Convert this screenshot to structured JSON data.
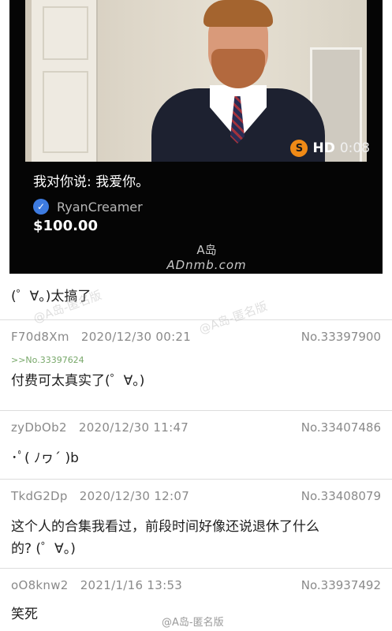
{
  "video": {
    "badge_coin": "S",
    "badge_hd": "HD",
    "duration": "0:08",
    "message": "我对你说: 我爱你。",
    "verified_mark": "✓",
    "username": "RyanCreamer",
    "amount": "$100.00",
    "logo_line1": "A岛",
    "logo_line2": "ADnmb.com"
  },
  "op_text": "(゜∀。)太搞了",
  "replies": [
    {
      "uid": "F70d8Xm",
      "datetime": "2020/12/30 00:21",
      "number": "No.33397900",
      "quote": ">>No.33397624",
      "text": "付费可太真实了(゜∀。)"
    },
    {
      "uid": "zyDbOb2",
      "datetime": "2020/12/30 11:47",
      "number": "No.33407486",
      "text": "･ﾟ( ﾉヮ´ )b"
    },
    {
      "uid": "TkdG2Dp",
      "datetime": "2020/12/30 12:07",
      "number": "No.33408079",
      "text_line1": "这个人的合集我看过，前段时间好像还说退休了什么",
      "text_line2": "的? (゜∀。)"
    },
    {
      "uid": "oO8knw2",
      "datetime": "2021/1/16 13:53",
      "number": "No.33937492",
      "text": "笑死"
    }
  ],
  "watermarks": {
    "faint_1": "@A岛-匿名版",
    "faint_2": "@A岛-匿名版",
    "bottom": "@A岛-匿名版"
  },
  "colors": {
    "video_bg": "#050505",
    "coin": "#f08a16",
    "verified": "#3d7be0",
    "quote_link": "#78a86a",
    "meta_gray": "#8a8a8a"
  }
}
